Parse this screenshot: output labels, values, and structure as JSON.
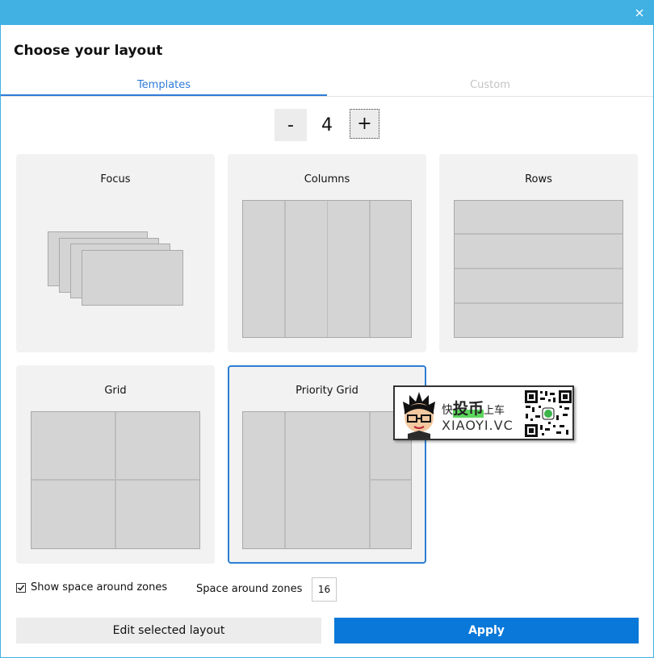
{
  "window": {
    "titlebar_color": "#41b0e3",
    "close_icon": "close-icon"
  },
  "heading": "Choose your layout",
  "tabs": [
    {
      "label": "Templates",
      "active": true
    },
    {
      "label": "Custom",
      "active": false
    }
  ],
  "zone_count": {
    "minus_label": "-",
    "value": "4",
    "plus_label": "+"
  },
  "layouts": [
    {
      "name": "Focus",
      "selected": false
    },
    {
      "name": "Columns",
      "selected": false
    },
    {
      "name": "Rows",
      "selected": false
    },
    {
      "name": "Grid",
      "selected": false
    },
    {
      "name": "Priority Grid",
      "selected": true
    }
  ],
  "watermark": {
    "line1_a": "快",
    "line1_b": "投币",
    "line1_c": "上车",
    "line2": "XIAOYI.VC"
  },
  "options": {
    "show_space_label": "Show space around zones",
    "show_space_checked": true,
    "space_label": "Space around zones",
    "space_value": "16"
  },
  "actions": {
    "edit_label": "Edit selected layout",
    "apply_label": "Apply",
    "accent_color": "#0a78d8"
  }
}
